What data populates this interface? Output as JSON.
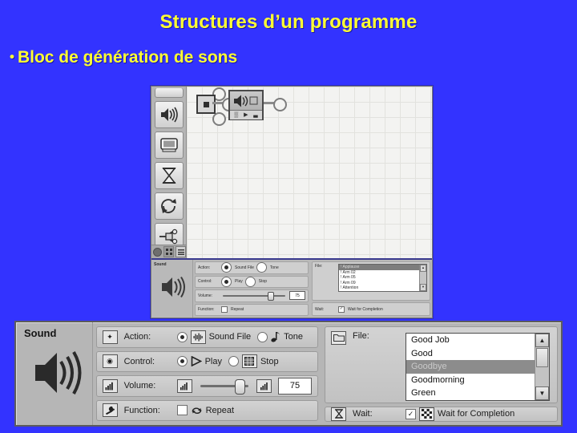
{
  "slide": {
    "title": "Structures d’un programme",
    "bullet": "Bloc de génération de sons",
    "bullet_marker": "•",
    "colors": {
      "background": "#3333ff",
      "text": "#ffff33"
    }
  },
  "editor": {
    "palette": [
      {
        "name": "sound-palette-icon",
        "label": "Son"
      },
      {
        "name": "display-palette-icon",
        "label": "Affichage"
      },
      {
        "name": "wait-palette-icon",
        "label": "Attente"
      },
      {
        "name": "loop-palette-icon",
        "label": "Boucle"
      },
      {
        "name": "switch-palette-icon",
        "label": "Aiguillage"
      }
    ],
    "palette_footer": [
      {
        "name": "common-palette-tab",
        "label": "●"
      },
      {
        "name": "complete-palette-tab",
        "label": "▣"
      },
      {
        "name": "custom-palette-tab",
        "label": "≡"
      }
    ],
    "canvas": {
      "start_block_label": "■",
      "sound_block": {
        "name": "sound-block",
        "indicators": [
          "▒",
          "▶",
          "▃"
        ]
      }
    }
  },
  "mini_panel": {
    "title": "Sound",
    "rows": {
      "action": {
        "label": "Action:",
        "opt1": "Sound File",
        "opt2": "Tone"
      },
      "control": {
        "label": "Control:",
        "opt1": "Play",
        "opt2": "Stop"
      },
      "volume": {
        "label": "Volume:",
        "value": "75"
      },
      "function": {
        "label": "Function:",
        "opt1": "Repeat"
      },
      "file": {
        "label": "File:"
      },
      "wait": {
        "label": "Wait:",
        "opt1": "Wait for Completion"
      }
    },
    "files": [
      "! Applause",
      "! Arm 02",
      "! Arm 05",
      "! Arm 09",
      "! Attention"
    ],
    "selected_file": "! Applause"
  },
  "sound_panel": {
    "title": "Sound",
    "action": {
      "label": "Action:",
      "options": [
        {
          "label": "Sound File",
          "selected": true,
          "icon": "waveform-icon"
        },
        {
          "label": "Tone",
          "selected": false,
          "icon": "note-icon"
        }
      ]
    },
    "control": {
      "label": "Control:",
      "options": [
        {
          "label": "Play",
          "selected": true,
          "icon": "play-icon"
        },
        {
          "label": "Stop",
          "selected": false,
          "icon": "stop-icon"
        }
      ]
    },
    "volume": {
      "label": "Volume:",
      "value": "75",
      "min_icon": "volume-low-icon",
      "max_icon": "volume-high-icon",
      "position_percent": 72
    },
    "function": {
      "label": "Function:",
      "repeat_label": "Repeat",
      "repeat_checked": false,
      "checkmark": ""
    },
    "file": {
      "label": "File:",
      "items": [
        "Good Job",
        "Good",
        "Goodbye",
        "Goodmorning",
        "Green"
      ],
      "selected": "Goodbye",
      "scroll_up": "▲",
      "scroll_down": "▼"
    },
    "wait": {
      "label": "Wait:",
      "option_label": "Wait for Completion",
      "checked": true,
      "checkmark": "✓"
    }
  }
}
